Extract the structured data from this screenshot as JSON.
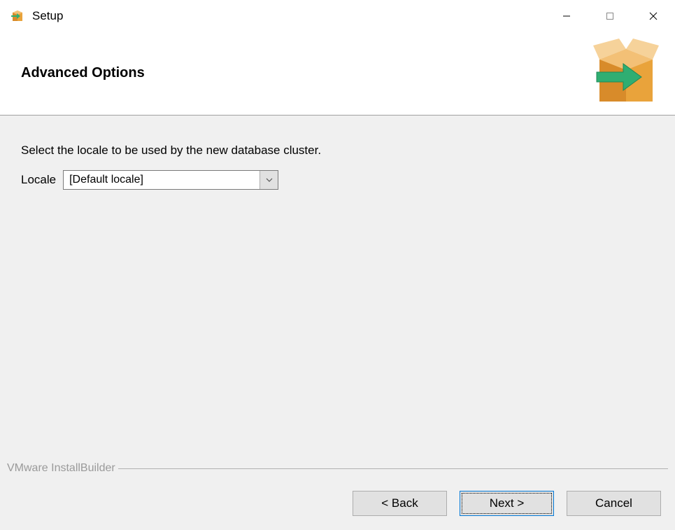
{
  "window": {
    "title": "Setup"
  },
  "header": {
    "title": "Advanced Options"
  },
  "content": {
    "instruction": "Select the locale to be used by the new database cluster.",
    "locale_label": "Locale",
    "locale_value": "[Default locale]"
  },
  "footer": {
    "builder_label": "VMware InstallBuilder",
    "back_label": "< Back",
    "next_label": "Next >",
    "cancel_label": "Cancel"
  }
}
